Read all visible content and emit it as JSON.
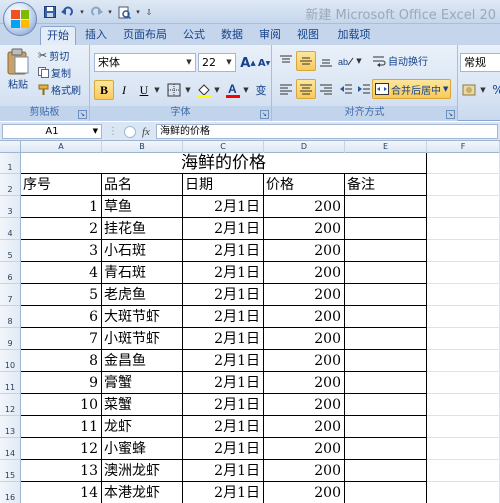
{
  "window": {
    "title": "新建 Microsoft Office Excel 20"
  },
  "tabs": [
    "开始",
    "插入",
    "页面布局",
    "公式",
    "数据",
    "审阅",
    "视图",
    "加载项"
  ],
  "ribbon": {
    "clipboard": {
      "paste": "粘贴",
      "cut": "剪切",
      "copy": "复制",
      "format_painter": "格式刷",
      "label": "剪贴板"
    },
    "font": {
      "name": "宋体",
      "size": "22",
      "bold": "B",
      "italic": "I",
      "underline": "U",
      "grow": "A",
      "shrink": "A",
      "label": "字体"
    },
    "alignment": {
      "wrap": "自动换行",
      "merge": "合并后居中",
      "label": "对齐方式"
    },
    "number": {
      "format": "常规",
      "percent": "%"
    }
  },
  "formula_bar": {
    "cell_ref": "A1",
    "fx": "fx",
    "content": "海鲜的价格"
  },
  "columns": [
    "A",
    "B",
    "C",
    "D",
    "E",
    "F"
  ],
  "sheet": {
    "title": "海鲜的价格",
    "headers": [
      "序号",
      "品名",
      "日期",
      "价格",
      "备注"
    ],
    "rows": [
      [
        "1",
        "草鱼",
        "2月1日",
        "200",
        ""
      ],
      [
        "2",
        "挂花鱼",
        "2月1日",
        "200",
        ""
      ],
      [
        "3",
        "小石斑",
        "2月1日",
        "200",
        ""
      ],
      [
        "4",
        "青石斑",
        "2月1日",
        "200",
        ""
      ],
      [
        "5",
        "老虎鱼",
        "2月1日",
        "200",
        ""
      ],
      [
        "6",
        "大斑节虾",
        "2月1日",
        "200",
        ""
      ],
      [
        "7",
        "小斑节虾",
        "2月1日",
        "200",
        ""
      ],
      [
        "8",
        "金昌鱼",
        "2月1日",
        "200",
        ""
      ],
      [
        "9",
        "膏蟹",
        "2月1日",
        "200",
        ""
      ],
      [
        "10",
        "菜蟹",
        "2月1日",
        "200",
        ""
      ],
      [
        "11",
        "龙虾",
        "2月1日",
        "200",
        ""
      ],
      [
        "12",
        "小蜜蜂",
        "2月1日",
        "200",
        ""
      ],
      [
        "13",
        "澳洲龙虾",
        "2月1日",
        "200",
        ""
      ],
      [
        "14",
        "本港龙虾",
        "2月1日",
        "200",
        ""
      ]
    ]
  }
}
